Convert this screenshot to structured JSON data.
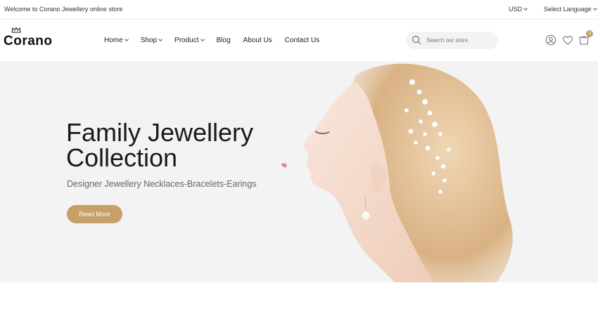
{
  "topbar": {
    "welcome": "Welcome to Corano Jewellery online store",
    "currency": "USD",
    "language": "Select Language"
  },
  "header": {
    "logo": "Corano",
    "nav": [
      {
        "label": "Home",
        "dropdown": true
      },
      {
        "label": "Shop",
        "dropdown": true
      },
      {
        "label": "Product",
        "dropdown": true
      },
      {
        "label": "Blog",
        "dropdown": false
      },
      {
        "label": "About Us",
        "dropdown": false
      },
      {
        "label": "Contact Us",
        "dropdown": false
      }
    ],
    "search_placeholder": "Search our store",
    "cart_count": "0",
    "icons": [
      "user-icon",
      "heart-icon",
      "cart-icon"
    ]
  },
  "hero": {
    "title_line1": "Family Jewellery",
    "title_line2": "Collection",
    "subtitle": "Designer Jewellery Necklaces-Bracelets-Earings",
    "button": "Read More",
    "background": "#f3f3f3"
  },
  "colors": {
    "accent": "#c5a069"
  }
}
